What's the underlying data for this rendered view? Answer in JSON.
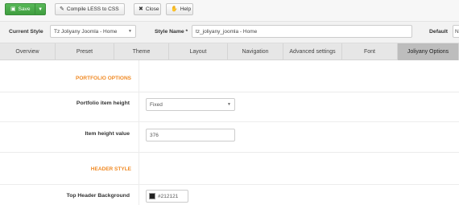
{
  "toolbar": {
    "save_label": "Save",
    "compile_label": "Compile LESS to CSS",
    "close_label": "Close",
    "help_label": "Help"
  },
  "stylebar": {
    "current_style_label": "Current Style",
    "current_style_value": "Tz Joliyany Joomla - Home",
    "style_name_label": "Style Name *",
    "style_name_value": "tz_joliyany_joomla - Home",
    "default_label": "Default",
    "default_value": "N"
  },
  "tabs": [
    "Overview",
    "Preset",
    "Theme",
    "Layout",
    "Navigation",
    "Advanced settings",
    "Font",
    "Joliyany Options"
  ],
  "active_tab": "Joliyany Options",
  "content": {
    "portfolio_section": "PORTFOLIO OPTIONS",
    "portfolio_height_label": "Portfolio item height",
    "portfolio_height_value": "Fixed",
    "item_height_label": "Item height value",
    "item_height_value": "376",
    "header_section": "HEADER STYLE",
    "top_header_bg_label": "Top Header Background",
    "top_header_bg_value": "#212121"
  },
  "colors": {
    "save_button": "#47a447",
    "section_heading": "#f08a24",
    "active_tab": "#bdbdbd",
    "swatch": "#212121"
  }
}
